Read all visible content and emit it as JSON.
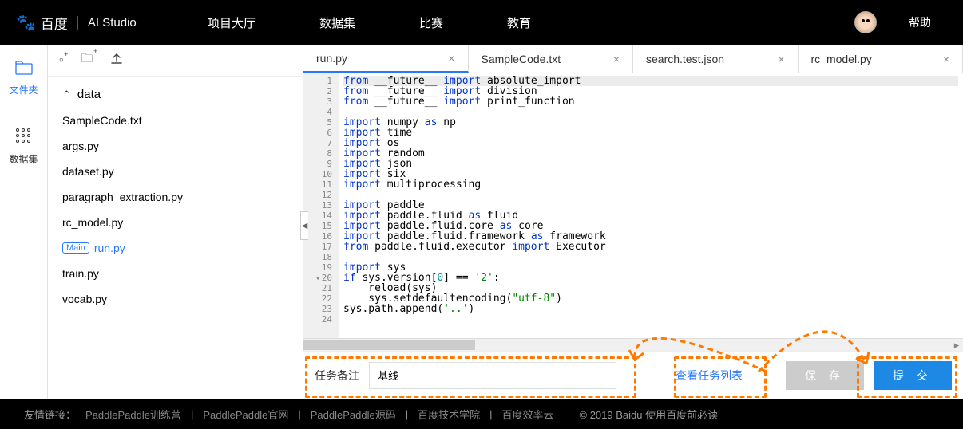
{
  "header": {
    "logo_brand": "百度",
    "logo_product": "AI Studio",
    "nav": [
      "项目大厅",
      "数据集",
      "比赛",
      "教育"
    ],
    "help": "帮助"
  },
  "leftbar": {
    "files": "文件夹",
    "datasets": "数据集"
  },
  "filetree": {
    "folder": "data",
    "files": [
      "SampleCode.txt",
      "args.py",
      "dataset.py",
      "paragraph_extraction.py",
      "rc_model.py",
      "run.py",
      "train.py",
      "vocab.py"
    ],
    "main_badge": "Main",
    "active": "run.py"
  },
  "tabs": [
    {
      "label": "run.py",
      "active": true
    },
    {
      "label": "SampleCode.txt",
      "active": false
    },
    {
      "label": "search.test.json",
      "active": false
    },
    {
      "label": "rc_model.py",
      "active": false
    }
  ],
  "code": [
    {
      "n": 1,
      "t": [
        "from",
        " __future__ ",
        "import",
        " absolute_import"
      ],
      "cls": [
        "kw",
        "fn",
        "kw",
        "fn"
      ]
    },
    {
      "n": 2,
      "t": [
        "from",
        " __future__ ",
        "import",
        " division"
      ],
      "cls": [
        "kw",
        "fn",
        "kw",
        "fn"
      ]
    },
    {
      "n": 3,
      "t": [
        "from",
        " __future__ ",
        "import",
        " print_function"
      ],
      "cls": [
        "kw",
        "fn",
        "kw",
        "fn"
      ]
    },
    {
      "n": 4,
      "t": [
        ""
      ],
      "cls": [
        ""
      ]
    },
    {
      "n": 5,
      "t": [
        "import",
        " numpy ",
        "as",
        " np"
      ],
      "cls": [
        "kw",
        "fn",
        "kw",
        "fn"
      ]
    },
    {
      "n": 6,
      "t": [
        "import",
        " time"
      ],
      "cls": [
        "kw",
        "fn"
      ]
    },
    {
      "n": 7,
      "t": [
        "import",
        " os"
      ],
      "cls": [
        "kw",
        "fn"
      ]
    },
    {
      "n": 8,
      "t": [
        "import",
        " random"
      ],
      "cls": [
        "kw",
        "fn"
      ]
    },
    {
      "n": 9,
      "t": [
        "import",
        " json"
      ],
      "cls": [
        "kw",
        "fn"
      ]
    },
    {
      "n": 10,
      "t": [
        "import",
        " six"
      ],
      "cls": [
        "kw",
        "fn"
      ]
    },
    {
      "n": 11,
      "t": [
        "import",
        " multiprocessing"
      ],
      "cls": [
        "kw",
        "fn"
      ]
    },
    {
      "n": 12,
      "t": [
        ""
      ],
      "cls": [
        ""
      ]
    },
    {
      "n": 13,
      "t": [
        "import",
        " paddle"
      ],
      "cls": [
        "kw",
        "fn"
      ]
    },
    {
      "n": 14,
      "t": [
        "import",
        " paddle.fluid ",
        "as",
        " fluid"
      ],
      "cls": [
        "kw",
        "fn",
        "kw",
        "fn"
      ]
    },
    {
      "n": 15,
      "t": [
        "import",
        " paddle.fluid.core ",
        "as",
        " core"
      ],
      "cls": [
        "kw",
        "fn",
        "kw",
        "fn"
      ]
    },
    {
      "n": 16,
      "t": [
        "import",
        " paddle.fluid.framework ",
        "as",
        " framework"
      ],
      "cls": [
        "kw",
        "fn",
        "kw",
        "fn"
      ]
    },
    {
      "n": 17,
      "t": [
        "from",
        " paddle.fluid.executor ",
        "import",
        " Executor"
      ],
      "cls": [
        "kw",
        "fn",
        "kw",
        "fn"
      ]
    },
    {
      "n": 18,
      "t": [
        ""
      ],
      "cls": [
        ""
      ]
    },
    {
      "n": 19,
      "t": [
        "import",
        " sys"
      ],
      "cls": [
        "kw",
        "fn"
      ]
    },
    {
      "n": 20,
      "mark": true,
      "t": [
        "if",
        " sys.version[",
        "0",
        "] == ",
        "'2'",
        ":"
      ],
      "cls": [
        "kw",
        "fn",
        "num",
        "fn",
        "str",
        "fn"
      ]
    },
    {
      "n": 21,
      "t": [
        "    reload(sys)"
      ],
      "cls": [
        "fn"
      ]
    },
    {
      "n": 22,
      "t": [
        "    sys.setdefaultencoding(",
        "\"utf-8\"",
        ")"
      ],
      "cls": [
        "fn",
        "str",
        "fn"
      ]
    },
    {
      "n": 23,
      "t": [
        "sys.path.append(",
        "'..'",
        ")"
      ],
      "cls": [
        "fn",
        "str",
        "fn"
      ]
    },
    {
      "n": 24,
      "t": [
        ""
      ],
      "cls": [
        ""
      ]
    }
  ],
  "bottom": {
    "label": "任务备注",
    "input_value": "基线",
    "view_tasks": "查看任务列表",
    "save": "保 存",
    "submit": "提 交"
  },
  "footer": {
    "friend": "友情链接：",
    "links": [
      "PaddlePaddle训练营",
      "PaddlePaddle官网",
      "PaddlePaddle源码",
      "百度技术学院",
      "百度效率云"
    ],
    "copyright": "© 2019 Baidu 使用百度前必读"
  }
}
